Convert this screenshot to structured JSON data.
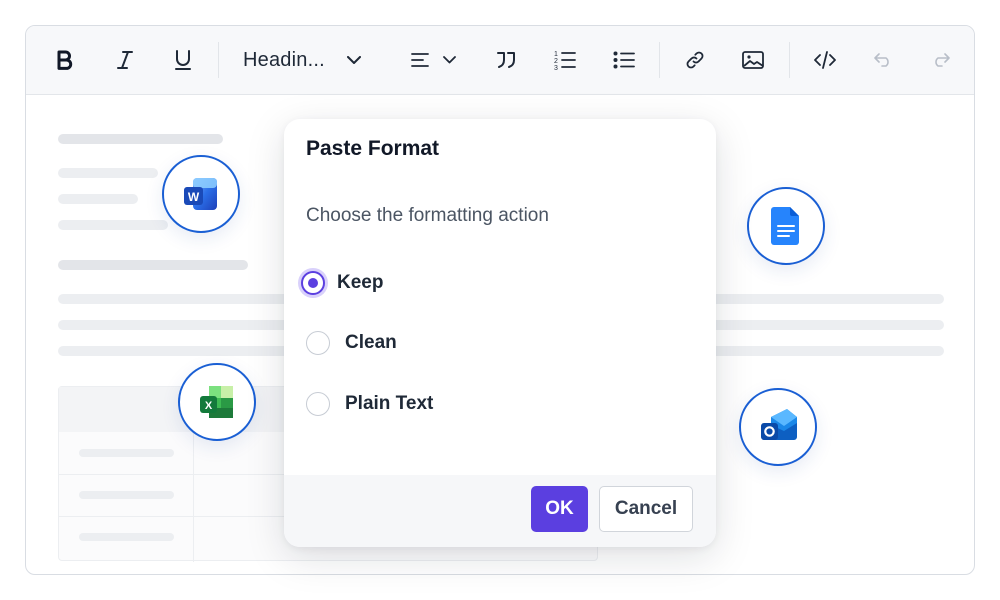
{
  "toolbar": {
    "heading_label": "Headin...",
    "buttons": [
      "bold-icon",
      "italic-icon",
      "underline-icon",
      "chevron-down-icon",
      "align-icon",
      "quote-icon",
      "ordered-list-icon",
      "bullet-list-icon",
      "link-icon",
      "image-icon",
      "code-icon",
      "undo-icon",
      "redo-icon"
    ]
  },
  "dialog": {
    "title": "Paste Format",
    "subtitle": "Choose the formatting action",
    "options": [
      {
        "label": "Keep",
        "selected": true
      },
      {
        "label": "Clean",
        "selected": false
      },
      {
        "label": "Plain Text",
        "selected": false
      }
    ],
    "ok_label": "OK",
    "cancel_label": "Cancel"
  },
  "badges": [
    "word-icon",
    "docs-icon",
    "excel-icon",
    "outlook-icon"
  ],
  "colors": {
    "accent": "#5b3fe0",
    "badge_border": "#1a5fd4",
    "toolbar_bg": "#f7f8fa"
  }
}
